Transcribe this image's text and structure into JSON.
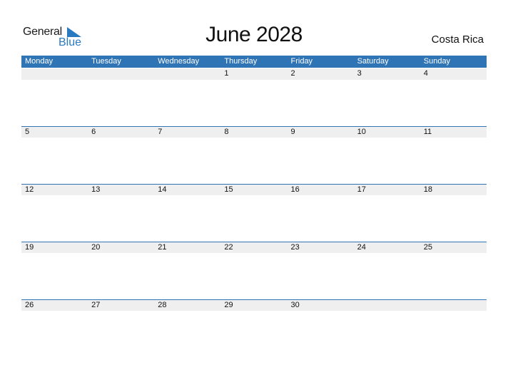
{
  "logo": {
    "word1": "General",
    "word2": "Blue",
    "accent": "#2a7ac0"
  },
  "header": {
    "title": "June 2028",
    "country": "Costa Rica"
  },
  "colors": {
    "header_bg": "#2f74b5",
    "day_bar_bg": "#efefef"
  },
  "weekdays": [
    "Monday",
    "Tuesday",
    "Wednesday",
    "Thursday",
    "Friday",
    "Saturday",
    "Sunday"
  ],
  "weeks": [
    [
      "",
      "",
      "",
      "1",
      "2",
      "3",
      "4"
    ],
    [
      "5",
      "6",
      "7",
      "8",
      "9",
      "10",
      "11"
    ],
    [
      "12",
      "13",
      "14",
      "15",
      "16",
      "17",
      "18"
    ],
    [
      "19",
      "20",
      "21",
      "22",
      "23",
      "24",
      "25"
    ],
    [
      "26",
      "27",
      "28",
      "29",
      "30",
      "",
      ""
    ]
  ]
}
